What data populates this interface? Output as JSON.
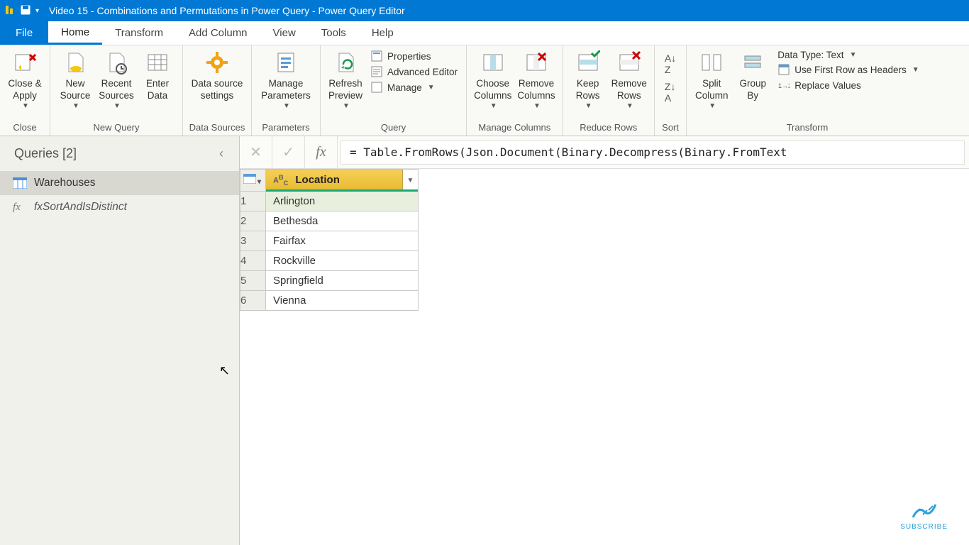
{
  "titlebar": {
    "title": "Video 15 - Combinations and Permutations in Power Query - Power Query Editor"
  },
  "tabs": {
    "file": "File",
    "home": "Home",
    "transform": "Transform",
    "addcolumn": "Add Column",
    "view": "View",
    "tools": "Tools",
    "help": "Help"
  },
  "ribbon": {
    "close_apply": "Close &\nApply",
    "close_group": "Close",
    "new_source": "New\nSource",
    "recent_sources": "Recent\nSources",
    "enter_data": "Enter\nData",
    "new_query_group": "New Query",
    "data_source_settings": "Data source\nsettings",
    "data_sources_group": "Data Sources",
    "manage_parameters": "Manage\nParameters",
    "parameters_group": "Parameters",
    "refresh_preview": "Refresh\nPreview",
    "properties": "Properties",
    "advanced_editor": "Advanced Editor",
    "manage": "Manage",
    "query_group": "Query",
    "choose_columns": "Choose\nColumns",
    "remove_columns": "Remove\nColumns",
    "manage_columns_group": "Manage Columns",
    "keep_rows": "Keep\nRows",
    "remove_rows": "Remove\nRows",
    "reduce_rows_group": "Reduce Rows",
    "sort_group": "Sort",
    "split_column": "Split\nColumn",
    "group_by": "Group\nBy",
    "data_type": "Data Type: Text",
    "first_row_headers": "Use First Row as Headers",
    "replace_values": "Replace Values",
    "transform_group": "Transform"
  },
  "queries": {
    "header": "Queries [2]",
    "items": [
      {
        "name": "Warehouses",
        "kind": "table"
      },
      {
        "name": "fxSortAndIsDistinct",
        "kind": "fx"
      }
    ]
  },
  "formula": "= Table.FromRows(Json.Document(Binary.Decompress(Binary.FromText",
  "grid": {
    "column_header": "Location",
    "rows": [
      "Arlington",
      "Bethesda",
      "Fairfax",
      "Rockville",
      "Springfield",
      "Vienna"
    ]
  },
  "subscribe": "SUBSCRIBE"
}
